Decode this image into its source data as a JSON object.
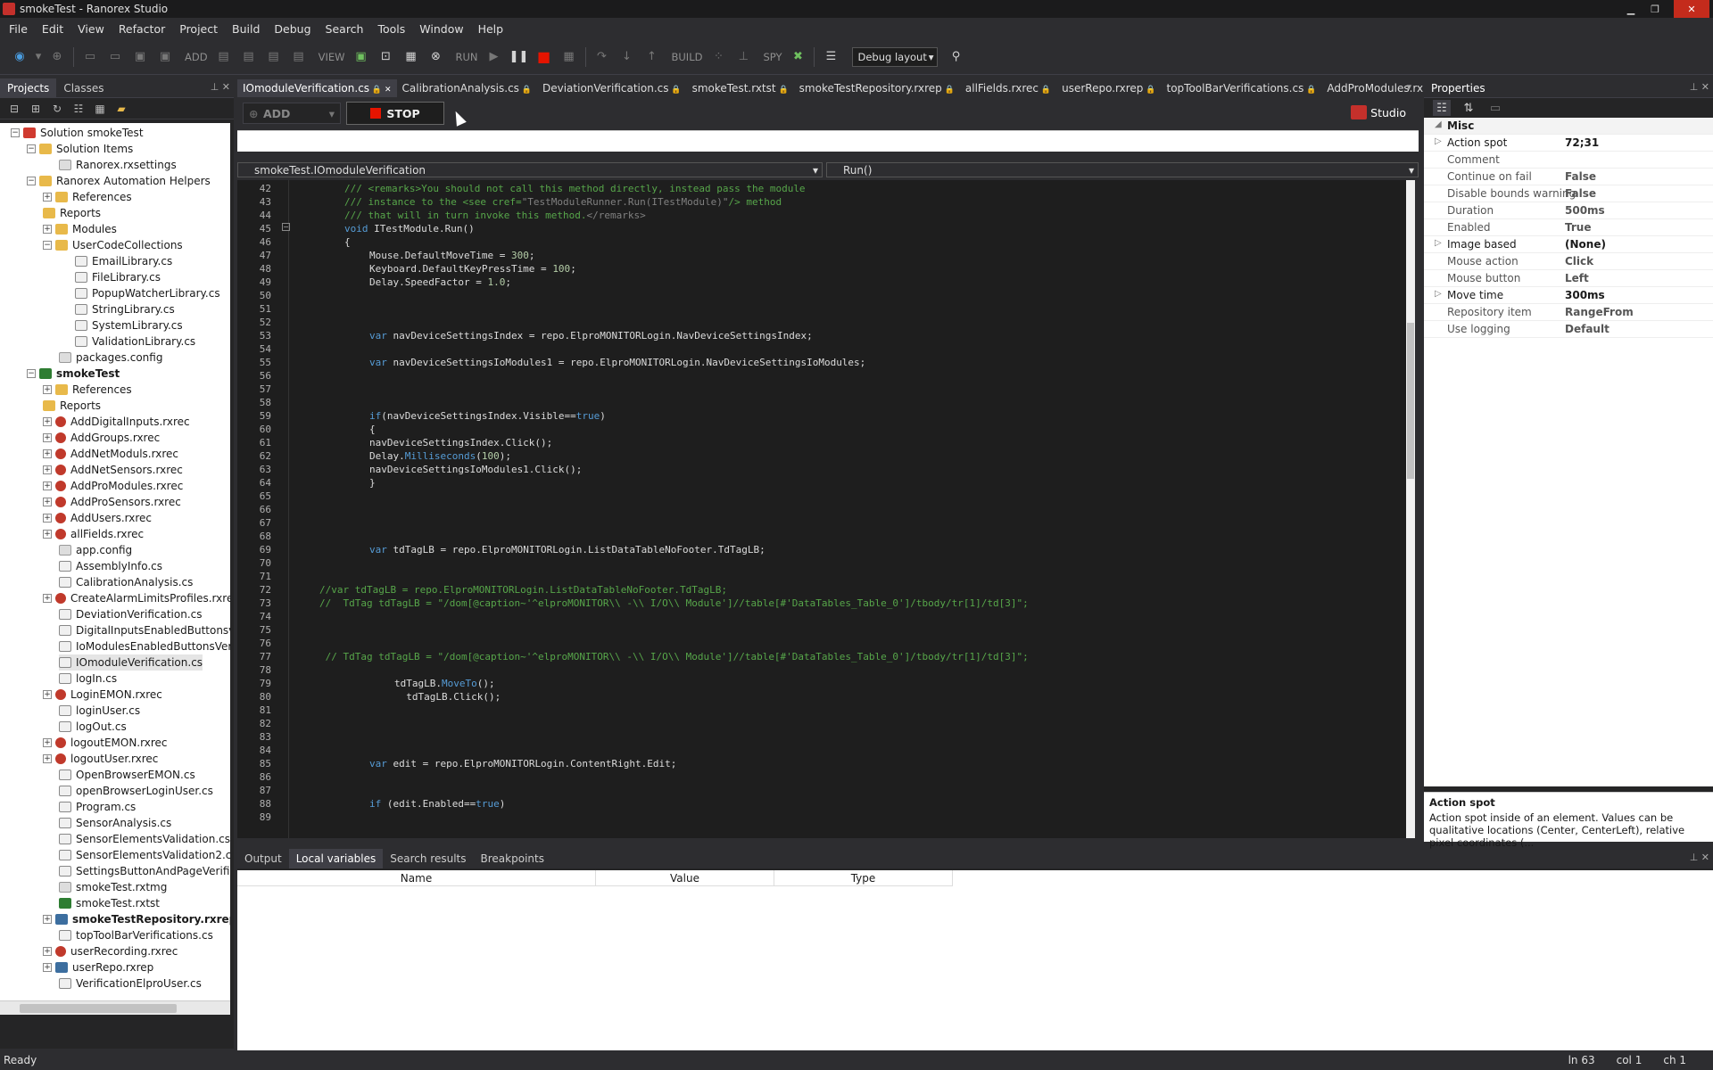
{
  "window": {
    "title": "smokeTest - Ranorex Studio"
  },
  "menu": [
    "File",
    "Edit",
    "View",
    "Refactor",
    "Project",
    "Build",
    "Debug",
    "Search",
    "Tools",
    "Window",
    "Help"
  ],
  "toolbar": {
    "add_label": "ADD",
    "view_label": "VIEW",
    "run_label": "RUN",
    "build_label": "BUILD",
    "spy_label": "SPY",
    "layout_value": "Debug layout"
  },
  "left_panel": {
    "tabs": [
      "Projects",
      "Classes"
    ],
    "tree": [
      {
        "label": "Solution smokeTest",
        "indent": 0,
        "exp": "−",
        "icon": "sol"
      },
      {
        "label": "Solution Items",
        "indent": 1,
        "exp": "−",
        "icon": "folder"
      },
      {
        "label": "Ranorex.rxsettings",
        "indent": 3,
        "exp": "",
        "icon": "cfg"
      },
      {
        "label": "Ranorex Automation Helpers",
        "indent": 1,
        "exp": "−",
        "icon": "folder"
      },
      {
        "label": "References",
        "indent": 2,
        "exp": "+",
        "icon": "folder"
      },
      {
        "label": "Reports",
        "indent": 2,
        "exp": "",
        "icon": "folder"
      },
      {
        "label": "Modules",
        "indent": 2,
        "exp": "+",
        "icon": "folder"
      },
      {
        "label": "UserCodeCollections",
        "indent": 2,
        "exp": "−",
        "icon": "folder"
      },
      {
        "label": "EmailLibrary.cs",
        "indent": 4,
        "exp": "",
        "icon": "cs"
      },
      {
        "label": "FileLibrary.cs",
        "indent": 4,
        "exp": "",
        "icon": "cs"
      },
      {
        "label": "PopupWatcherLibrary.cs",
        "indent": 4,
        "exp": "",
        "icon": "cs"
      },
      {
        "label": "StringLibrary.cs",
        "indent": 4,
        "exp": "",
        "icon": "cs"
      },
      {
        "label": "SystemLibrary.cs",
        "indent": 4,
        "exp": "",
        "icon": "cs"
      },
      {
        "label": "ValidationLibrary.cs",
        "indent": 4,
        "exp": "",
        "icon": "cs"
      },
      {
        "label": "packages.config",
        "indent": 3,
        "exp": "",
        "icon": "cfg"
      },
      {
        "label": "smokeTest",
        "indent": 1,
        "exp": "−",
        "icon": "proj",
        "bold": true
      },
      {
        "label": "References",
        "indent": 2,
        "exp": "+",
        "icon": "folder"
      },
      {
        "label": "Reports",
        "indent": 2,
        "exp": "",
        "icon": "folder"
      },
      {
        "label": "AddDigitalInputs.rxrec",
        "indent": 2,
        "exp": "+",
        "icon": "rxrec"
      },
      {
        "label": "AddGroups.rxrec",
        "indent": 2,
        "exp": "+",
        "icon": "rxrec"
      },
      {
        "label": "AddNetModuls.rxrec",
        "indent": 2,
        "exp": "+",
        "icon": "rxrec"
      },
      {
        "label": "AddNetSensors.rxrec",
        "indent": 2,
        "exp": "+",
        "icon": "rxrec"
      },
      {
        "label": "AddProModules.rxrec",
        "indent": 2,
        "exp": "+",
        "icon": "rxrec"
      },
      {
        "label": "AddProSensors.rxrec",
        "indent": 2,
        "exp": "+",
        "icon": "rxrec"
      },
      {
        "label": "AddUsers.rxrec",
        "indent": 2,
        "exp": "+",
        "icon": "rxrec"
      },
      {
        "label": "allFields.rxrec",
        "indent": 2,
        "exp": "+",
        "icon": "rxrec"
      },
      {
        "label": "app.config",
        "indent": 3,
        "exp": "",
        "icon": "cfg"
      },
      {
        "label": "AssemblyInfo.cs",
        "indent": 3,
        "exp": "",
        "icon": "cs"
      },
      {
        "label": "CalibrationAnalysis.cs",
        "indent": 3,
        "exp": "",
        "icon": "cs"
      },
      {
        "label": "CreateAlarmLimitsProfiles.rxrec",
        "indent": 2,
        "exp": "+",
        "icon": "rxrec"
      },
      {
        "label": "DeviationVerification.cs",
        "indent": 3,
        "exp": "",
        "icon": "cs"
      },
      {
        "label": "DigitalInputsEnabledButtonsverif",
        "indent": 3,
        "exp": "",
        "icon": "cs"
      },
      {
        "label": "IoModulesEnabledButtonsVerific",
        "indent": 3,
        "exp": "",
        "icon": "cs"
      },
      {
        "label": "IOmoduleVerification.cs",
        "indent": 3,
        "exp": "",
        "icon": "cs",
        "sel": true
      },
      {
        "label": "logIn.cs",
        "indent": 3,
        "exp": "",
        "icon": "cs"
      },
      {
        "label": "LoginEMON.rxrec",
        "indent": 2,
        "exp": "+",
        "icon": "rxrec"
      },
      {
        "label": "loginUser.cs",
        "indent": 3,
        "exp": "",
        "icon": "cs"
      },
      {
        "label": "logOut.cs",
        "indent": 3,
        "exp": "",
        "icon": "cs"
      },
      {
        "label": "logoutEMON.rxrec",
        "indent": 2,
        "exp": "+",
        "icon": "rxrec"
      },
      {
        "label": "logoutUser.rxrec",
        "indent": 2,
        "exp": "+",
        "icon": "rxrec"
      },
      {
        "label": "OpenBrowserEMON.cs",
        "indent": 3,
        "exp": "",
        "icon": "cs"
      },
      {
        "label": "openBrowserLoginUser.cs",
        "indent": 3,
        "exp": "",
        "icon": "cs"
      },
      {
        "label": "Program.cs",
        "indent": 3,
        "exp": "",
        "icon": "cs"
      },
      {
        "label": "SensorAnalysis.cs",
        "indent": 3,
        "exp": "",
        "icon": "cs"
      },
      {
        "label": "SensorElementsValidation.cs",
        "indent": 3,
        "exp": "",
        "icon": "cs"
      },
      {
        "label": "SensorElementsValidation2.cs",
        "indent": 3,
        "exp": "",
        "icon": "cs"
      },
      {
        "label": "SettingsButtonAndPageVerificati",
        "indent": 3,
        "exp": "",
        "icon": "cs"
      },
      {
        "label": "smokeTest.rxtmg",
        "indent": 3,
        "exp": "",
        "icon": "cfg"
      },
      {
        "label": "smokeTest.rxtst",
        "indent": 3,
        "exp": "",
        "icon": "proj"
      },
      {
        "label": "smokeTestRepository.rxrep",
        "indent": 2,
        "exp": "+",
        "icon": "rep",
        "bold": true
      },
      {
        "label": "topToolBarVerifications.cs",
        "indent": 3,
        "exp": "",
        "icon": "cs"
      },
      {
        "label": "userRecording.rxrec",
        "indent": 2,
        "exp": "+",
        "icon": "rxrec"
      },
      {
        "label": "userRepo.rxrep",
        "indent": 2,
        "exp": "+",
        "icon": "rep"
      },
      {
        "label": "VerificationElproUser.cs",
        "indent": 3,
        "exp": "",
        "icon": "cs"
      }
    ]
  },
  "editor": {
    "tabs": [
      "IOmoduleVerification.cs",
      "CalibrationAnalysis.cs",
      "DeviationVerification.cs",
      "smokeTest.rxtst",
      "smokeTestRepository.rxrep",
      "allFields.rxrec",
      "userRepo.rxrep",
      "topToolBarVerifications.cs",
      "AddProModules.rxrec"
    ],
    "add_button": "ADD",
    "stop_button": "STOP",
    "studio_label": "Studio",
    "class_selector": "smokeTest.IOmoduleVerification",
    "member_selector": "Run()",
    "lines": [
      {
        "n": "42",
        "html": "<span class='cm'>/// &lt;remarks&gt;You should not call this method directly, instead pass the module</span>",
        "ind": 0
      },
      {
        "n": "43",
        "html": "<span class='cm'>/// instance to the &lt;see cref=<span class='xmlcm'>\"TestModuleRunner.Run(ITestModule)\"</span>/&gt; method</span>",
        "ind": 0
      },
      {
        "n": "44",
        "html": "<span class='cm'>/// that will in turn invoke this method.<span class='xmlcm'>&lt;/remarks&gt;</span></span>",
        "ind": 0
      },
      {
        "n": "45",
        "html": "<span class='kw'>void</span> ITestModule.Run()",
        "ind": 0
      },
      {
        "n": "46",
        "html": "{",
        "ind": 0
      },
      {
        "n": "47",
        "html": "Mouse.DefaultMoveTime = <span class='num'>300</span>;",
        "ind": 1
      },
      {
        "n": "48",
        "html": "Keyboard.DefaultKeyPressTime = <span class='num'>100</span>;",
        "ind": 1
      },
      {
        "n": "49",
        "html": "Delay.SpeedFactor = <span class='num'>1.0</span>;",
        "ind": 1
      },
      {
        "n": "50",
        "html": "",
        "ind": 0
      },
      {
        "n": "51",
        "html": "",
        "ind": 0
      },
      {
        "n": "52",
        "html": "",
        "ind": 0
      },
      {
        "n": "53",
        "html": "<span class='kw'>var</span> navDeviceSettingsIndex = repo.ElproMONITORLogin.NavDeviceSettingsIndex;",
        "ind": 1
      },
      {
        "n": "54",
        "html": "",
        "ind": 0
      },
      {
        "n": "55",
        "html": "<span class='kw'>var</span> navDeviceSettingsIoModules1 = repo.ElproMONITORLogin.NavDeviceSettingsIoModules;",
        "ind": 1
      },
      {
        "n": "56",
        "html": "",
        "ind": 0
      },
      {
        "n": "57",
        "html": "",
        "ind": 0
      },
      {
        "n": "58",
        "html": "",
        "ind": 0
      },
      {
        "n": "59",
        "html": "<span class='kw'>if</span>(navDeviceSettingsIndex.Visible==<span class='kw'>true</span>)",
        "ind": 1
      },
      {
        "n": "60",
        "html": "{",
        "ind": 1
      },
      {
        "n": "61",
        "html": "navDeviceSettingsIndex.Click();",
        "ind": 1
      },
      {
        "n": "62",
        "html": "Delay.<span class='kw'>Milliseconds</span>(<span class='num'>100</span>);",
        "ind": 1
      },
      {
        "n": "63",
        "html": "navDeviceSettingsIoModules1.Click();",
        "ind": 1
      },
      {
        "n": "64",
        "html": "}",
        "ind": 1
      },
      {
        "n": "65",
        "html": "",
        "ind": 0
      },
      {
        "n": "66",
        "html": "",
        "ind": 0
      },
      {
        "n": "67",
        "html": "",
        "ind": 0
      },
      {
        "n": "68",
        "html": "",
        "ind": 0
      },
      {
        "n": "69",
        "html": "<span class='kw'>var</span> tdTagLB = repo.ElproMONITORLogin.ListDataTableNoFooter.TdTagLB;",
        "ind": 1
      },
      {
        "n": "70",
        "html": "",
        "ind": 0
      },
      {
        "n": "71",
        "html": "",
        "ind": 0
      },
      {
        "n": "72",
        "html": "<span class='cm'>//var tdTagLB = repo.ElproMONITORLogin.ListDataTableNoFooter.TdTagLB;</span>",
        "ind": -1
      },
      {
        "n": "73",
        "html": "<span class='cm'>//  TdTag tdTagLB = \"/dom[@caption~'^elproMONITOR\\\\ -\\\\ I/O\\\\ Module']//table[#'DataTables_Table_0']/tbody/tr[1]/td[3]\";</span>",
        "ind": -1
      },
      {
        "n": "74",
        "html": "",
        "ind": 0
      },
      {
        "n": "75",
        "html": "",
        "ind": 0
      },
      {
        "n": "76",
        "html": "",
        "ind": 0
      },
      {
        "n": "77",
        "html": "<span class='cm'> // TdTag tdTagLB = \"/dom[@caption~'^elproMONITOR\\\\ -\\\\ I/O\\\\ Module']//table[#'DataTables_Table_0']/tbody/tr[1]/td[3]\";</span>",
        "ind": -1
      },
      {
        "n": "78",
        "html": "",
        "ind": 0
      },
      {
        "n": "79",
        "html": "tdTagLB.<span class='kw'>MoveTo</span>();",
        "ind": 2
      },
      {
        "n": "80",
        "html": "  tdTagLB.Click();",
        "ind": 2
      },
      {
        "n": "81",
        "html": "",
        "ind": 0
      },
      {
        "n": "82",
        "html": "",
        "ind": 0
      },
      {
        "n": "83",
        "html": "",
        "ind": 0
      },
      {
        "n": "84",
        "html": "",
        "ind": 0
      },
      {
        "n": "85",
        "html": "<span class='kw'>var</span> edit = repo.ElproMONITORLogin.ContentRight.Edit;",
        "ind": 1
      },
      {
        "n": "86",
        "html": "",
        "ind": 0
      },
      {
        "n": "87",
        "html": "",
        "ind": 0
      },
      {
        "n": "88",
        "html": "<span class='kw'>if</span> (edit.Enabled==<span class='kw'>true</span>)",
        "ind": 1
      },
      {
        "n": "89",
        "html": "",
        "ind": 0
      }
    ]
  },
  "properties": {
    "title": "Properties",
    "category": "Misc",
    "rows": [
      {
        "key": "Action spot",
        "value": "72;31",
        "exp": "▷",
        "dark": true
      },
      {
        "key": "Comment",
        "value": ""
      },
      {
        "key": "Continue on fail",
        "value": "False"
      },
      {
        "key": "Disable bounds warning",
        "value": "False"
      },
      {
        "key": "Duration",
        "value": "500ms"
      },
      {
        "key": "Enabled",
        "value": "True"
      },
      {
        "key": "Image based",
        "value": "(None)",
        "exp": "▷",
        "dark": true
      },
      {
        "key": "Mouse action",
        "value": "Click"
      },
      {
        "key": "Mouse button",
        "value": "Left"
      },
      {
        "key": "Move time",
        "value": "300ms",
        "exp": "▷",
        "dark": true
      },
      {
        "key": "Repository item",
        "value": "RangeFrom"
      },
      {
        "key": "Use logging",
        "value": "Default"
      }
    ],
    "desc_title": "Action spot",
    "desc_text": "Action spot inside of an element. Values can be qualitative locations (Center, CenterLeft), relative pixel coordinates (..."
  },
  "bottom": {
    "tabs": [
      "Output",
      "Local variables",
      "Search results",
      "Breakpoints"
    ],
    "columns": [
      "Name",
      "Value",
      "Type"
    ]
  },
  "status": {
    "left": "Ready",
    "ln": "ln 63",
    "col": "col 1",
    "ch": "ch 1"
  }
}
